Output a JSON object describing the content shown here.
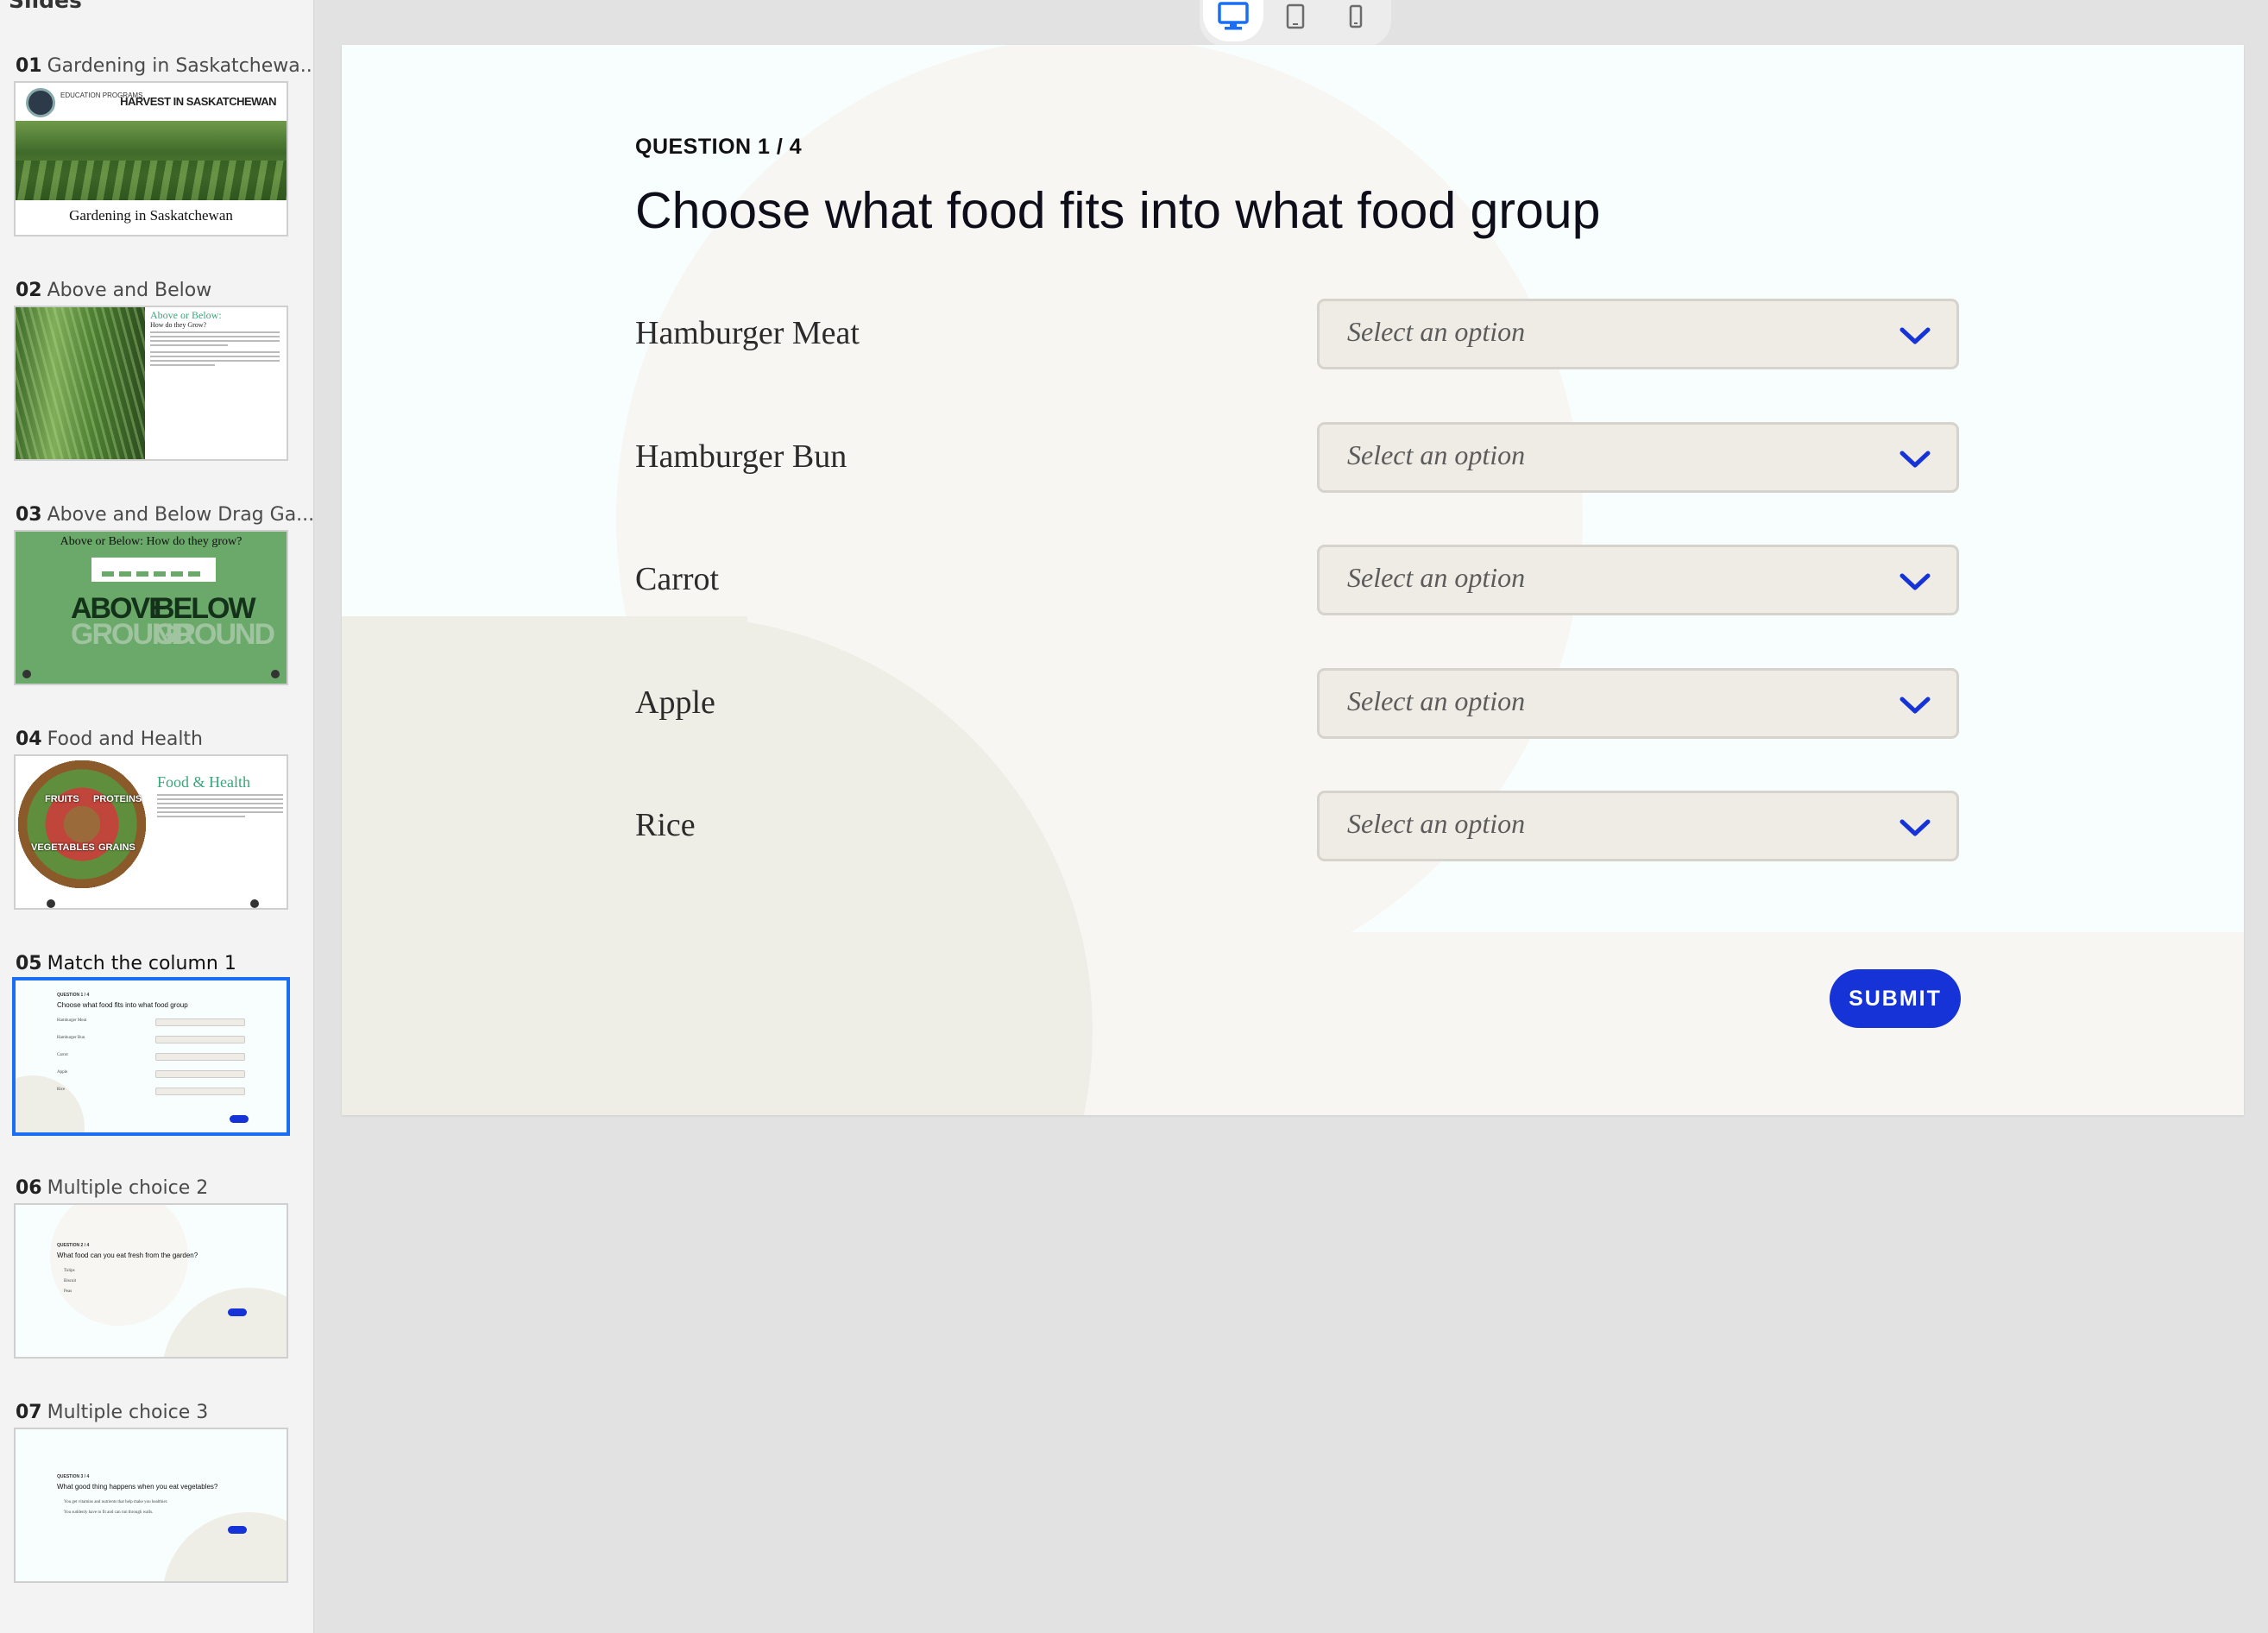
{
  "sidebar": {
    "title": "Slides",
    "slides": [
      {
        "num": "01",
        "title": "Gardening in Saskatchewa..."
      },
      {
        "num": "02",
        "title": "Above and Below"
      },
      {
        "num": "03",
        "title": "Above and Below Drag Ga..."
      },
      {
        "num": "04",
        "title": "Food and Health"
      },
      {
        "num": "05",
        "title": "Match the column 1"
      },
      {
        "num": "06",
        "title": "Multiple choice 2"
      },
      {
        "num": "07",
        "title": "Multiple choice 3"
      }
    ],
    "active_slide": "05",
    "thumb1": {
      "edu": "EDUCATION PROGRAMS",
      "header": "HARVEST IN SASKATCHEWAN",
      "caption": "Gardening in Saskatchewan"
    },
    "thumb2": {
      "title": "Above or Below:",
      "subtitle": "How do they Grow?"
    },
    "thumb3": {
      "title": "Above or Below: How do they grow?",
      "above": "ABOVE",
      "below": "BELOW",
      "ground": "GROUND"
    },
    "thumb4": {
      "title": "Food & Health",
      "fruits": "FRUITS",
      "proteins": "PROTEINS",
      "vegetables": "VEGETABLES",
      "grains": "GRAINS"
    },
    "thumb5": {
      "question": "QUESTION 1 / 4",
      "title": "Choose what food fits into what food group",
      "rows": [
        "Hamburger Meat",
        "Hamburger Bun",
        "Carrot",
        "Apple",
        "Rice"
      ],
      "option": "Select an option",
      "button": "SUBMIT"
    },
    "thumb6": {
      "question": "QUESTION 2 / 4",
      "title": "What food can you eat fresh from the garden?",
      "options": [
        "Tulips",
        "Biscuit",
        "Peas"
      ],
      "button": "SUBMIT"
    },
    "thumb7": {
      "question": "QUESTION 3 / 4",
      "title": "What good thing happens when you eat vegetables?",
      "options": [
        "You get vitamins and nutrients that help make you healthier.",
        "You suddenly have to fit and can run through walls."
      ],
      "button": "SUBMIT"
    }
  },
  "device_toggle": {
    "options": [
      {
        "name": "desktop-icon",
        "active": true
      },
      {
        "name": "tablet-icon",
        "active": false
      },
      {
        "name": "mobile-icon",
        "active": false
      }
    ]
  },
  "question": {
    "counter": "QUESTION 1 / 4",
    "title": "Choose what food fits into what food group",
    "rows": [
      {
        "label": "Hamburger Meat",
        "placeholder": "Select an option"
      },
      {
        "label": "Hamburger Bun",
        "placeholder": "Select an option"
      },
      {
        "label": "Carrot",
        "placeholder": "Select an option"
      },
      {
        "label": "Apple",
        "placeholder": "Select an option"
      },
      {
        "label": "Rice",
        "placeholder": "Select an option"
      }
    ],
    "submit_label": "SUBMIT"
  },
  "colors": {
    "accent": "#1533d6",
    "selection_border": "#1a6ef3",
    "slide_bg": "#f8fefe",
    "shape_light": "#f7f6f2",
    "shape_dark": "#efeee6"
  }
}
